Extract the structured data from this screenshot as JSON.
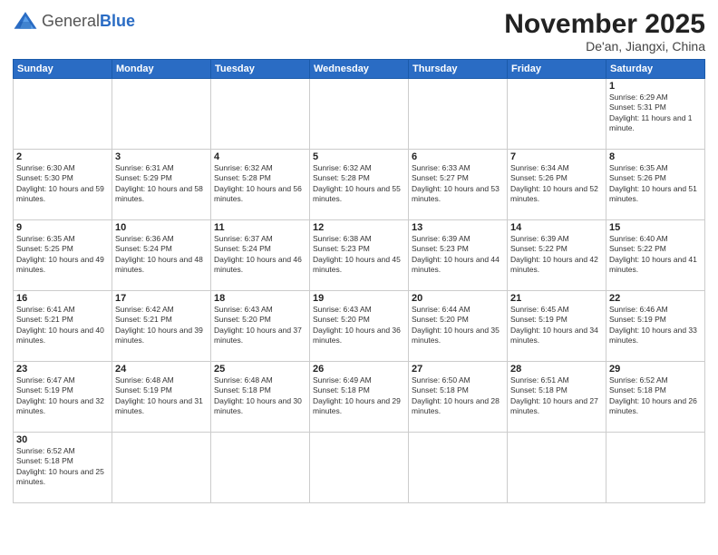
{
  "logo": {
    "general": "General",
    "blue": "Blue"
  },
  "header": {
    "month": "November 2025",
    "location": "De'an, Jiangxi, China"
  },
  "weekdays": [
    "Sunday",
    "Monday",
    "Tuesday",
    "Wednesday",
    "Thursday",
    "Friday",
    "Saturday"
  ],
  "weeks": [
    [
      {
        "day": "",
        "info": ""
      },
      {
        "day": "",
        "info": ""
      },
      {
        "day": "",
        "info": ""
      },
      {
        "day": "",
        "info": ""
      },
      {
        "day": "",
        "info": ""
      },
      {
        "day": "",
        "info": ""
      },
      {
        "day": "1",
        "info": "Sunrise: 6:29 AM\nSunset: 5:31 PM\nDaylight: 11 hours and 1 minute."
      }
    ],
    [
      {
        "day": "2",
        "info": "Sunrise: 6:30 AM\nSunset: 5:30 PM\nDaylight: 10 hours and 59 minutes."
      },
      {
        "day": "3",
        "info": "Sunrise: 6:31 AM\nSunset: 5:29 PM\nDaylight: 10 hours and 58 minutes."
      },
      {
        "day": "4",
        "info": "Sunrise: 6:32 AM\nSunset: 5:28 PM\nDaylight: 10 hours and 56 minutes."
      },
      {
        "day": "5",
        "info": "Sunrise: 6:32 AM\nSunset: 5:28 PM\nDaylight: 10 hours and 55 minutes."
      },
      {
        "day": "6",
        "info": "Sunrise: 6:33 AM\nSunset: 5:27 PM\nDaylight: 10 hours and 53 minutes."
      },
      {
        "day": "7",
        "info": "Sunrise: 6:34 AM\nSunset: 5:26 PM\nDaylight: 10 hours and 52 minutes."
      },
      {
        "day": "8",
        "info": "Sunrise: 6:35 AM\nSunset: 5:26 PM\nDaylight: 10 hours and 51 minutes."
      }
    ],
    [
      {
        "day": "9",
        "info": "Sunrise: 6:35 AM\nSunset: 5:25 PM\nDaylight: 10 hours and 49 minutes."
      },
      {
        "day": "10",
        "info": "Sunrise: 6:36 AM\nSunset: 5:24 PM\nDaylight: 10 hours and 48 minutes."
      },
      {
        "day": "11",
        "info": "Sunrise: 6:37 AM\nSunset: 5:24 PM\nDaylight: 10 hours and 46 minutes."
      },
      {
        "day": "12",
        "info": "Sunrise: 6:38 AM\nSunset: 5:23 PM\nDaylight: 10 hours and 45 minutes."
      },
      {
        "day": "13",
        "info": "Sunrise: 6:39 AM\nSunset: 5:23 PM\nDaylight: 10 hours and 44 minutes."
      },
      {
        "day": "14",
        "info": "Sunrise: 6:39 AM\nSunset: 5:22 PM\nDaylight: 10 hours and 42 minutes."
      },
      {
        "day": "15",
        "info": "Sunrise: 6:40 AM\nSunset: 5:22 PM\nDaylight: 10 hours and 41 minutes."
      }
    ],
    [
      {
        "day": "16",
        "info": "Sunrise: 6:41 AM\nSunset: 5:21 PM\nDaylight: 10 hours and 40 minutes."
      },
      {
        "day": "17",
        "info": "Sunrise: 6:42 AM\nSunset: 5:21 PM\nDaylight: 10 hours and 39 minutes."
      },
      {
        "day": "18",
        "info": "Sunrise: 6:43 AM\nSunset: 5:20 PM\nDaylight: 10 hours and 37 minutes."
      },
      {
        "day": "19",
        "info": "Sunrise: 6:43 AM\nSunset: 5:20 PM\nDaylight: 10 hours and 36 minutes."
      },
      {
        "day": "20",
        "info": "Sunrise: 6:44 AM\nSunset: 5:20 PM\nDaylight: 10 hours and 35 minutes."
      },
      {
        "day": "21",
        "info": "Sunrise: 6:45 AM\nSunset: 5:19 PM\nDaylight: 10 hours and 34 minutes."
      },
      {
        "day": "22",
        "info": "Sunrise: 6:46 AM\nSunset: 5:19 PM\nDaylight: 10 hours and 33 minutes."
      }
    ],
    [
      {
        "day": "23",
        "info": "Sunrise: 6:47 AM\nSunset: 5:19 PM\nDaylight: 10 hours and 32 minutes."
      },
      {
        "day": "24",
        "info": "Sunrise: 6:48 AM\nSunset: 5:19 PM\nDaylight: 10 hours and 31 minutes."
      },
      {
        "day": "25",
        "info": "Sunrise: 6:48 AM\nSunset: 5:18 PM\nDaylight: 10 hours and 30 minutes."
      },
      {
        "day": "26",
        "info": "Sunrise: 6:49 AM\nSunset: 5:18 PM\nDaylight: 10 hours and 29 minutes."
      },
      {
        "day": "27",
        "info": "Sunrise: 6:50 AM\nSunset: 5:18 PM\nDaylight: 10 hours and 28 minutes."
      },
      {
        "day": "28",
        "info": "Sunrise: 6:51 AM\nSunset: 5:18 PM\nDaylight: 10 hours and 27 minutes."
      },
      {
        "day": "29",
        "info": "Sunrise: 6:52 AM\nSunset: 5:18 PM\nDaylight: 10 hours and 26 minutes."
      }
    ],
    [
      {
        "day": "30",
        "info": "Sunrise: 6:52 AM\nSunset: 5:18 PM\nDaylight: 10 hours and 25 minutes."
      },
      {
        "day": "",
        "info": ""
      },
      {
        "day": "",
        "info": ""
      },
      {
        "day": "",
        "info": ""
      },
      {
        "day": "",
        "info": ""
      },
      {
        "day": "",
        "info": ""
      },
      {
        "day": "",
        "info": ""
      }
    ]
  ]
}
